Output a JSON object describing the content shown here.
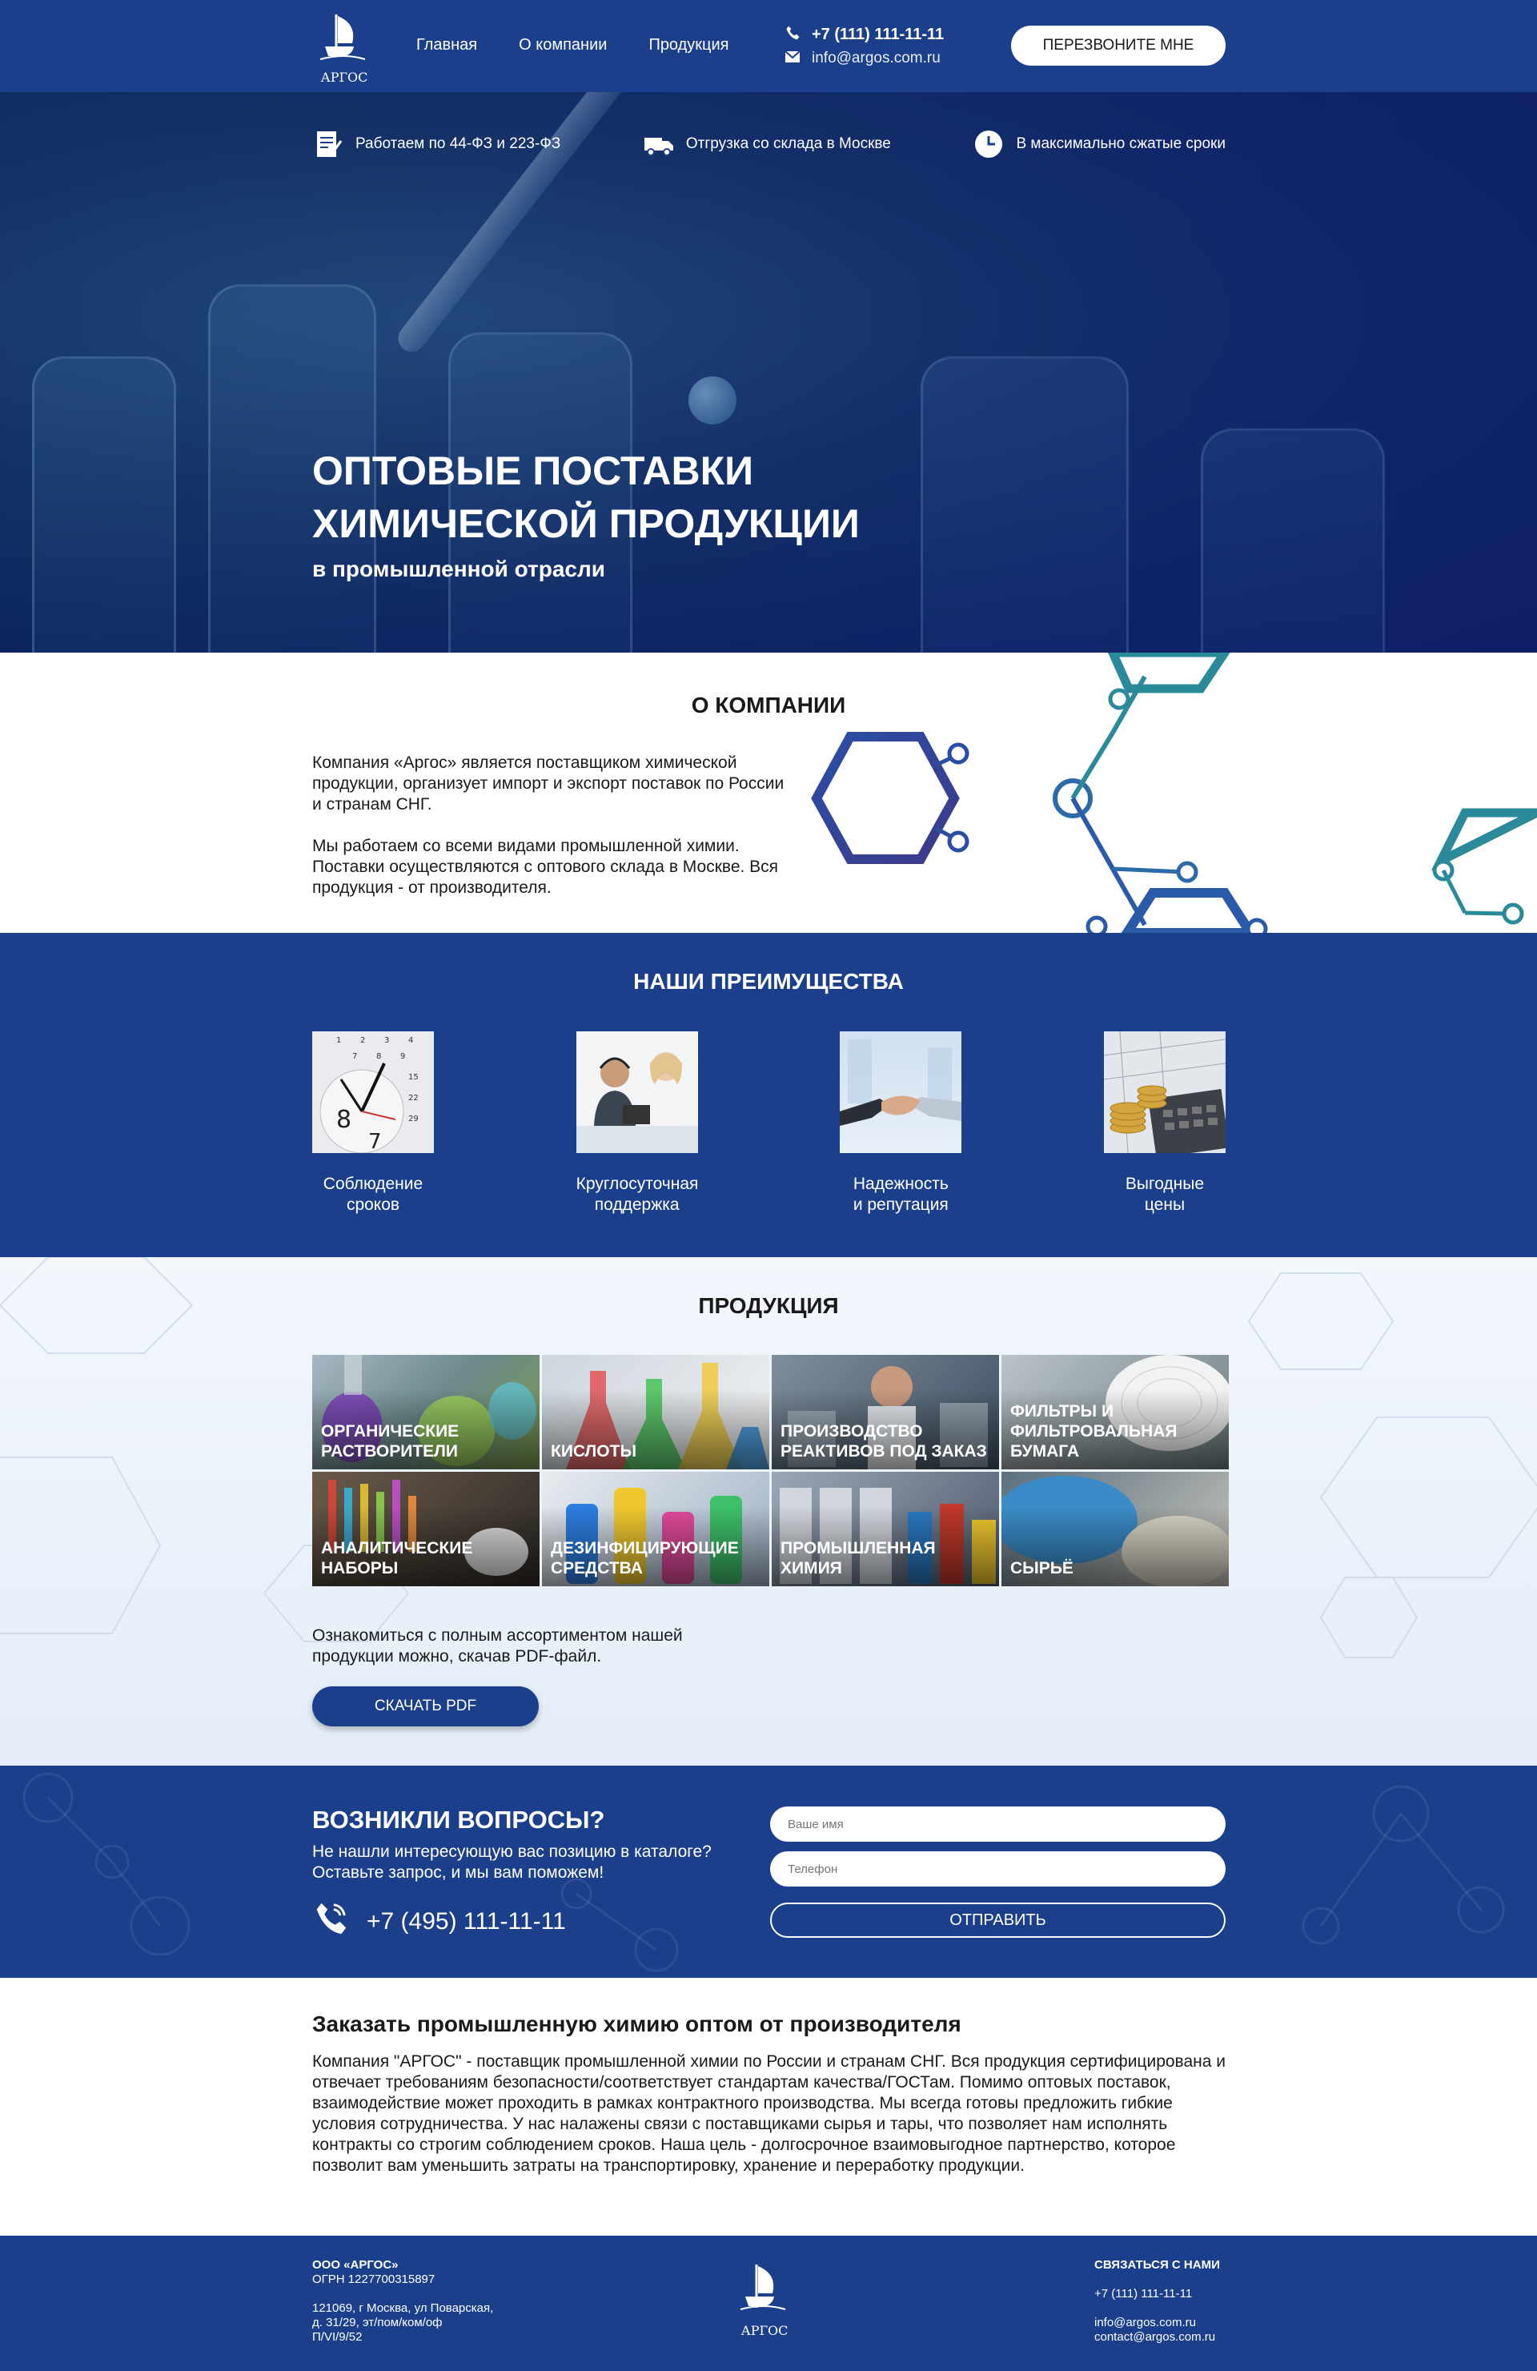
{
  "header": {
    "brand": "АРГОС",
    "nav": [
      {
        "label": "Главная"
      },
      {
        "label": "О компании"
      },
      {
        "label": "Продукция"
      }
    ],
    "phone": "+7 (111) 111-11-11",
    "email": "info@argos.com.ru",
    "callback_label": "ПЕРЕЗВОНИТЕ МНЕ"
  },
  "hero": {
    "features": [
      {
        "icon": "document-icon",
        "text": "Работаем по 44-ФЗ и 223-ФЗ"
      },
      {
        "icon": "delivery-truck-icon",
        "text": "Отгрузка со склада в Москве"
      },
      {
        "icon": "clock-icon",
        "text": "В максимально сжатые сроки"
      }
    ],
    "title_line1": "ОПТОВЫЕ ПОСТАВКИ",
    "title_line2": "ХИМИЧЕСКОЙ ПРОДУКЦИИ",
    "subtitle": "в промышленной отрасли"
  },
  "about": {
    "title": "О КОМПАНИИ",
    "p1": "Компания «Аргос» является поставщиком химической продукции, организует импорт и экспорт поставок по России и странам СНГ.",
    "p2": "Мы работаем со всеми видами промышленной химии. Поставки осуществляются с оптового склада в Москве. Вся продукция - от производителя."
  },
  "advantages": {
    "title": "НАШИ ПРЕИМУЩЕСТВА",
    "items": [
      {
        "line1": "Соблюдение",
        "line2": "сроков"
      },
      {
        "line1": "Круглосуточная",
        "line2": "поддержка"
      },
      {
        "line1": "Надежность",
        "line2": "и репутация"
      },
      {
        "line1": "Выгодные",
        "line2": "цены"
      }
    ]
  },
  "products": {
    "title": "ПРОДУКЦИЯ",
    "items": [
      {
        "line1": "ОРГАНИЧЕСКИЕ",
        "line2": "РАСТВОРИТЕЛИ",
        "line3": ""
      },
      {
        "line1": "КИСЛОТЫ",
        "line2": "",
        "line3": ""
      },
      {
        "line1": "ПРОИЗВОДСТВО",
        "line2": "РЕАКТИВОВ ПОД ЗАКАЗ",
        "line3": ""
      },
      {
        "line1": "ФИЛЬТРЫ И",
        "line2": "ФИЛЬТРОВАЛЬНАЯ",
        "line3": "БУМАГА"
      },
      {
        "line1": "АНАЛИТИЧЕСКИЕ",
        "line2": "НАБОРЫ",
        "line3": ""
      },
      {
        "line1": "ДЕЗИНФИЦИРУЮЩИЕ",
        "line2": "СРЕДСТВА",
        "line3": ""
      },
      {
        "line1": "ПРОМЫШЛЕННАЯ",
        "line2": "ХИМИЯ",
        "line3": ""
      },
      {
        "line1": "СЫРЬЁ",
        "line2": "",
        "line3": ""
      }
    ],
    "note": "Ознакомиться с полным ассортиментом нашей продукции можно, скачав PDF-файл.",
    "pdf_label": "СКАЧАТЬ PDF"
  },
  "faq": {
    "title": "ВОЗНИКЛИ ВОПРОСЫ?",
    "sub_line1": "Не нашли интересующую вас позицию в каталоге?",
    "sub_line2": "Оставьте запрос, и мы вам поможем!",
    "phone": "+7 (495) 111-11-11",
    "name_placeholder": "Ваше имя",
    "phone_placeholder": "Телефон",
    "send_label": "ОТПРАВИТЬ"
  },
  "seo": {
    "title": "Заказать промышленную химию оптом от производителя",
    "body": "Компания \"АРГОС\" - поставщик промышленной химии по России и странам СНГ. Вся продукция сертифицирована и отвечает требованиям безопасности/соответствует стандартам качества/ГОСТам. Помимо оптовых поставок, взаимодействие может проходить в рамках контрактного производства. Мы всегда готовы предложить гибкие условия сотрудничества. У нас налажены связи с поставщиками сырья и тары, что позволяет нам исполнять контракты со строгим соблюдением сроков. Наша цель - долгосрочное взаимовыгодное партнерство, которое позволит вам уменьшить затраты на транспортировку, хранение и переработку продукции."
  },
  "footer": {
    "company": "ООО «АРГОС»",
    "ogrn": "ОГРН 1227700315897",
    "address_line1": "121069, г Москва, ул Поварская,",
    "address_line2": "д. 31/29, эт/пом/ком/оф",
    "address_line3": "П/VI/9/52",
    "brand": "АРГОС",
    "contact_title": "СВЯЗАТЬСЯ С НАМИ",
    "phone": "+7 (111) 111-11-11",
    "email1": "info@argos.com.ru",
    "email2": "contact@argos.com.ru"
  },
  "colors": {
    "primary": "#1c3f8b",
    "teal": "#2a8a9a"
  }
}
